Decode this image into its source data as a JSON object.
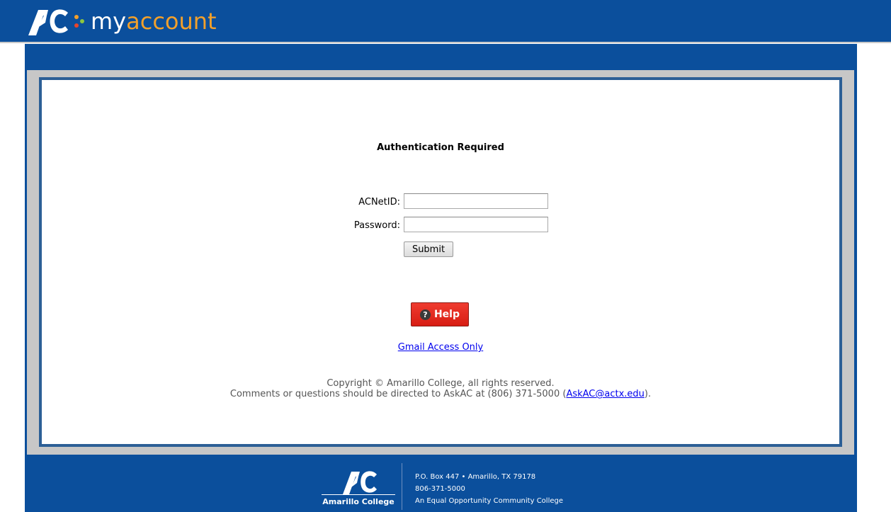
{
  "header": {
    "logo_my": "my",
    "logo_account": "account"
  },
  "form": {
    "title": "Authentication Required",
    "id_label": "ACNetID:",
    "password_label": "Password:",
    "id_value": "",
    "password_value": "",
    "submit_label": "Submit"
  },
  "help": {
    "icon_glyph": "?",
    "label": "Help"
  },
  "links": {
    "gmail": "Gmail Access Only"
  },
  "copyright": {
    "line1": "Copyright © Amarillo College, all rights reserved.",
    "line2_prefix": "Comments or questions should be directed to AskAC at (806) 371-5000 (",
    "email": "AskAC@actx.edu",
    "line2_suffix": ")."
  },
  "footer": {
    "logo_name": "Amarillo College",
    "address": "P.O. Box 447 • Amarillo, TX 79178",
    "phone": "806-371-5000",
    "tagline": "An Equal Opportunity Community College"
  },
  "colors": {
    "brand_blue": "#0b4f9c",
    "frame_gray": "#c7c7c7",
    "accent_orange": "#f2a02b",
    "help_red": "#e0281d"
  }
}
